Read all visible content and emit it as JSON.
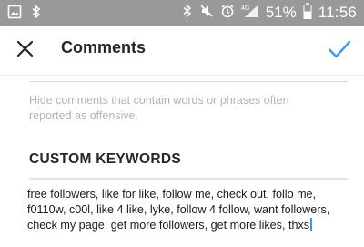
{
  "status_bar": {
    "battery_pct": "51%",
    "time": "11:56",
    "network_label": "4G",
    "icons": [
      "image-icon",
      "bluetooth-icon",
      "bluetooth-icon",
      "mute-icon",
      "alarm-icon",
      "signal-icon",
      "battery-icon"
    ]
  },
  "header": {
    "title": "Comments",
    "close_icon": "close-icon",
    "confirm_icon": "checkmark-icon",
    "accent_color": "#3897f0"
  },
  "main": {
    "hint": "Hide comments that contain words or phrases often reported as offensive.",
    "custom_keywords_heading": "CUSTOM KEYWORDS",
    "keywords_value": "free followers, like for like, follow me, check out, follo me, f0110w, c00l, like 4 like, lyke, follow 4 follow, want followers, check my page, get more followers, get more likes, thxs"
  }
}
